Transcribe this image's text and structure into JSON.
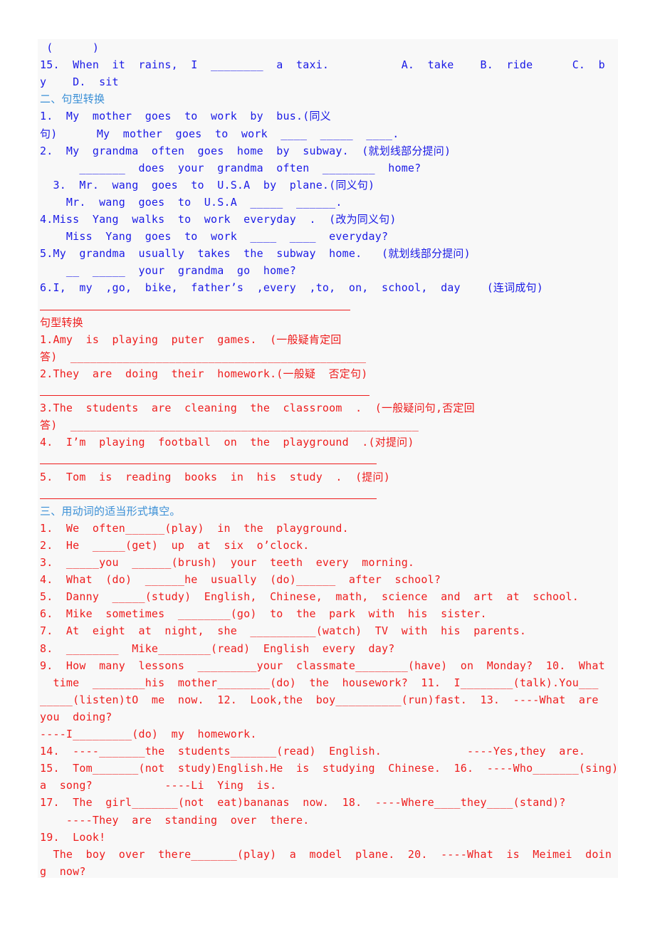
{
  "document": {
    "lines": [
      {
        "text": " (      )",
        "color": "blue"
      },
      {
        "text": "15.  When  it  rains,  I  ________  a  taxi.           A.  take    B.  ride      C.  b",
        "color": "blue"
      },
      {
        "text": "y    D.  sit",
        "color": "blue"
      },
      {
        "text": "二、句型转换",
        "color": "heading-blue"
      },
      {
        "text": "1.  My  mother  goes  to  work  by  bus.(同义",
        "color": "blue"
      },
      {
        "text": "句)      My  mother  goes  to  work  ____  _____  ____.",
        "color": "blue"
      },
      {
        "text": "2.  My  grandma  often  goes  home  by  subway.  (就划线部分提问)",
        "color": "blue"
      },
      {
        "text": "      _______  does  your  grandma  often  ________  home?",
        "color": "blue"
      },
      {
        "text": "  3.  Mr.  wang  goes  to  U.S.A  by  plane.(同义句)",
        "color": "blue"
      },
      {
        "text": "    Mr.  wang  goes  to  U.S.A  _____  ______.",
        "color": "blue"
      },
      {
        "text": "4.Miss  Yang  walks  to  work  everyday  .  (改为同义句)",
        "color": "blue"
      },
      {
        "text": "    Miss  Yang  goes  to  work  ____  ____  everyday?",
        "color": "blue"
      },
      {
        "text": "5.My  grandma  usually  takes  the  subway  home.   (就划线部分提问)",
        "color": "blue"
      },
      {
        "text": "    __  _____  your  grandma  go  home?",
        "color": "blue"
      },
      {
        "text": "6.I,  my  ,go,  bike,  father’s  ,every  ,to,  on,  school,  day    (连词成句)",
        "color": "blue"
      },
      {
        "text": "",
        "color": "red"
      },
      {
        "text": "句型转换",
        "color": "heading-red"
      },
      {
        "text": "1.Amy  is  playing  puter  games.  (一般疑肯定回",
        "color": "red"
      },
      {
        "text": "答)  _____________________________________________",
        "color": "red"
      },
      {
        "text": "2.They  are  doing  their  homework.(一般疑  否定句)",
        "color": "red"
      },
      {
        "text": "",
        "color": "red"
      },
      {
        "text": "3.The  students  are  cleaning  the  classroom  .  (一般疑问句,否定回",
        "color": "red"
      },
      {
        "text": "答)  _____________________________________________________",
        "color": "red"
      },
      {
        "text": "4.  I’m  playing  football  on  the  playground  .(对提问)",
        "color": "red"
      },
      {
        "text": "",
        "color": "red"
      },
      {
        "text": "5.  Tom  is  reading  books  in  his  study  .  (提问)",
        "color": "red"
      },
      {
        "text": "",
        "color": "red"
      },
      {
        "text": "三、用动词的适当形式填空。",
        "color": "heading-blue"
      },
      {
        "text": "1.  We  often______(play)  in  the  playground.",
        "color": "red"
      },
      {
        "text": "2.  He  _____(get)  up  at  six  o’clock.",
        "color": "red"
      },
      {
        "text": "3.  _____you  ______(brush)  your  teeth  every  morning.",
        "color": "red"
      },
      {
        "text": "4.  What  (do)  ______he  usually  (do)______  after  school?",
        "color": "red"
      },
      {
        "text": "5.  Danny  _____(study)  English,  Chinese,  math,  science  and  art  at  school.",
        "color": "red"
      },
      {
        "text": "6.  Mike  sometimes  ________(go)  to  the  park  with  his  sister.",
        "color": "red"
      },
      {
        "text": "7.  At  eight  at  night,  she  __________(watch)  TV  with  his  parents.",
        "color": "red"
      },
      {
        "text": "8.  ________  Mike________(read)  English  every  day?",
        "color": "red"
      },
      {
        "text": "9.  How  many  lessons  _________your  classmate________(have)  on  Monday?  10.  What",
        "color": "red"
      },
      {
        "text": "  time  ________his  mother________(do)  the  housework?  11.  I________(talk).You___",
        "color": "red"
      },
      {
        "text": "_____(listen)tO  me  now.  12.  Look,the  boy__________(run)fast.  13.  ----What  are",
        "color": "red"
      },
      {
        "text": "you  doing?",
        "color": "red"
      },
      {
        "text": "----I_________(do)  my  homework.",
        "color": "red"
      },
      {
        "text": "14.  ----_______the  students_______(read)  English.             ----Yes,they  are.",
        "color": "red"
      },
      {
        "text": "15.  Tom_______(not  study)English.He  is  studying  Chinese.  16.  ----Who_______(sing)",
        "color": "red"
      },
      {
        "text": "a  song?           ----Li  Ying  is.",
        "color": "red"
      },
      {
        "text": "17.  The  girl_______(not  eat)bananas  now.  18.  ----Where____they____(stand)?",
        "color": "red"
      },
      {
        "text": "    ----They  are  standing  over  there.",
        "color": "red"
      },
      {
        "text": "19.  Look!",
        "color": "red"
      },
      {
        "text": "  The  boy  over  there_______(play)  a  model  plane.  20.  ----What  is  Meimei  doin",
        "color": "red"
      },
      {
        "text": "g  now?",
        "color": "red"
      }
    ]
  }
}
